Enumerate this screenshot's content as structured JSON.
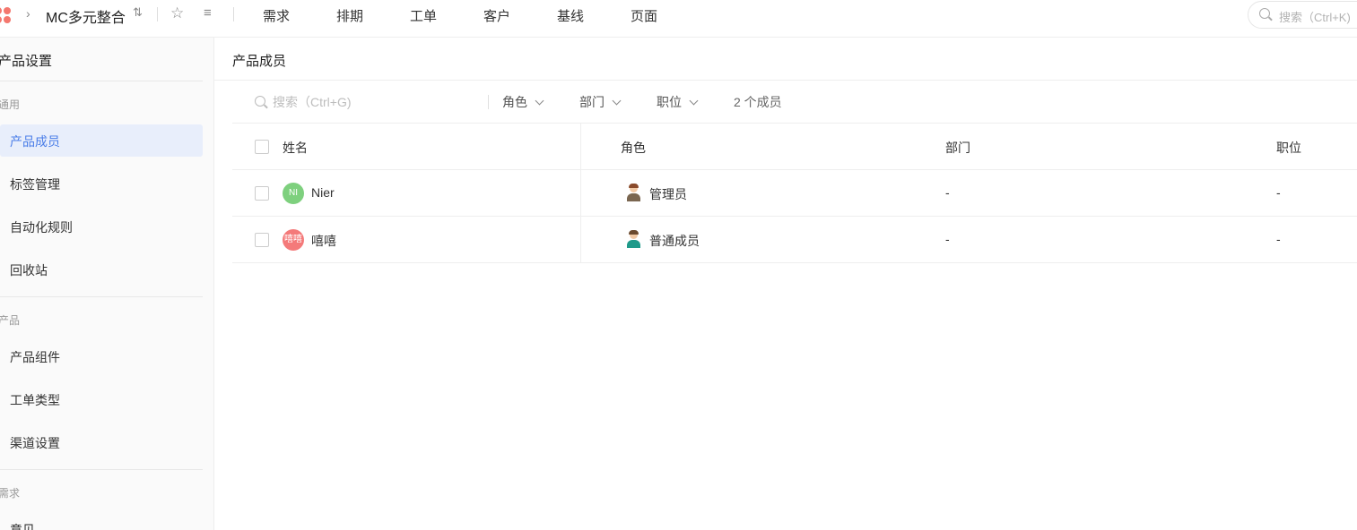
{
  "topbar": {
    "product_name": "MC多元整合",
    "nav_tabs": [
      "需求",
      "排期",
      "工单",
      "客户",
      "基线",
      "页面"
    ],
    "search_placeholder": "搜索（Ctrl+K)"
  },
  "sidebar": {
    "title": "产品设置",
    "groups": [
      {
        "label": "通用",
        "items": [
          "产品成员",
          "标签管理",
          "自动化规则",
          "回收站"
        ]
      },
      {
        "label": "产品",
        "items": [
          "产品组件",
          "工单类型",
          "渠道设置"
        ]
      },
      {
        "label": "需求",
        "items": [
          "意见"
        ]
      }
    ],
    "active_item": "产品成员"
  },
  "main": {
    "title": "产品成员",
    "toolbar": {
      "search_placeholder": "搜索（Ctrl+G)",
      "filters": [
        "角色",
        "部门",
        "职位"
      ],
      "count_text": "2 个成员"
    },
    "table": {
      "headers": [
        "姓名",
        "角色",
        "部门",
        "职位"
      ],
      "rows": [
        {
          "avatar_text": "NI",
          "avatar_color": "#7ed07e",
          "name": "Nier",
          "role": "管理员",
          "dept": "-",
          "position": "-"
        },
        {
          "avatar_text": "嘻嘻",
          "avatar_color": "#f47a7a",
          "name": "嘻嘻",
          "role": "普通成员",
          "dept": "-",
          "position": "-"
        }
      ]
    }
  },
  "colors": {
    "accent": "#4a7de8",
    "active_bg": "#e8eefb",
    "logo": "#f4776e"
  }
}
